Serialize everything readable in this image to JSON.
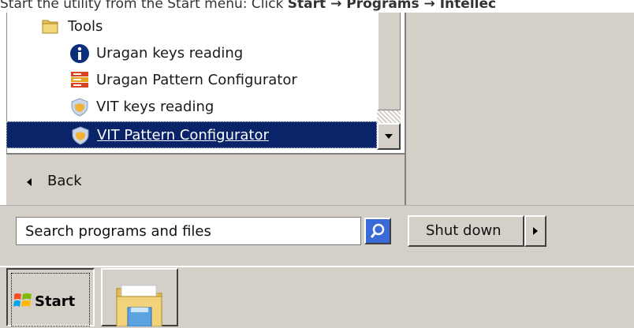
{
  "caption": {
    "prefix": "Start the utility from the Start menu: Click ",
    "path1": "Start",
    "sep1": " → ",
    "path2": "Programs",
    "sep2": " → ",
    "path3": "Intellec"
  },
  "start_menu": {
    "programs": [
      {
        "label": "Tools",
        "icon": "folder-icon"
      },
      {
        "label": "Uragan keys reading",
        "icon": "info-icon"
      },
      {
        "label": "Uragan Pattern Configurator",
        "icon": "configurator-icon"
      },
      {
        "label": "VIT keys reading",
        "icon": "shield-icon"
      },
      {
        "label": "VIT Pattern Configurator",
        "icon": "shield-icon",
        "selected": true
      }
    ],
    "back_label": "Back",
    "search_placeholder": "Search programs and files",
    "shutdown_label": "Shut down"
  },
  "taskbar": {
    "start_label": "Start"
  },
  "colors": {
    "selection": "#0a246a",
    "face": "#d4d0c8",
    "search_button": "#3a6ad8"
  }
}
